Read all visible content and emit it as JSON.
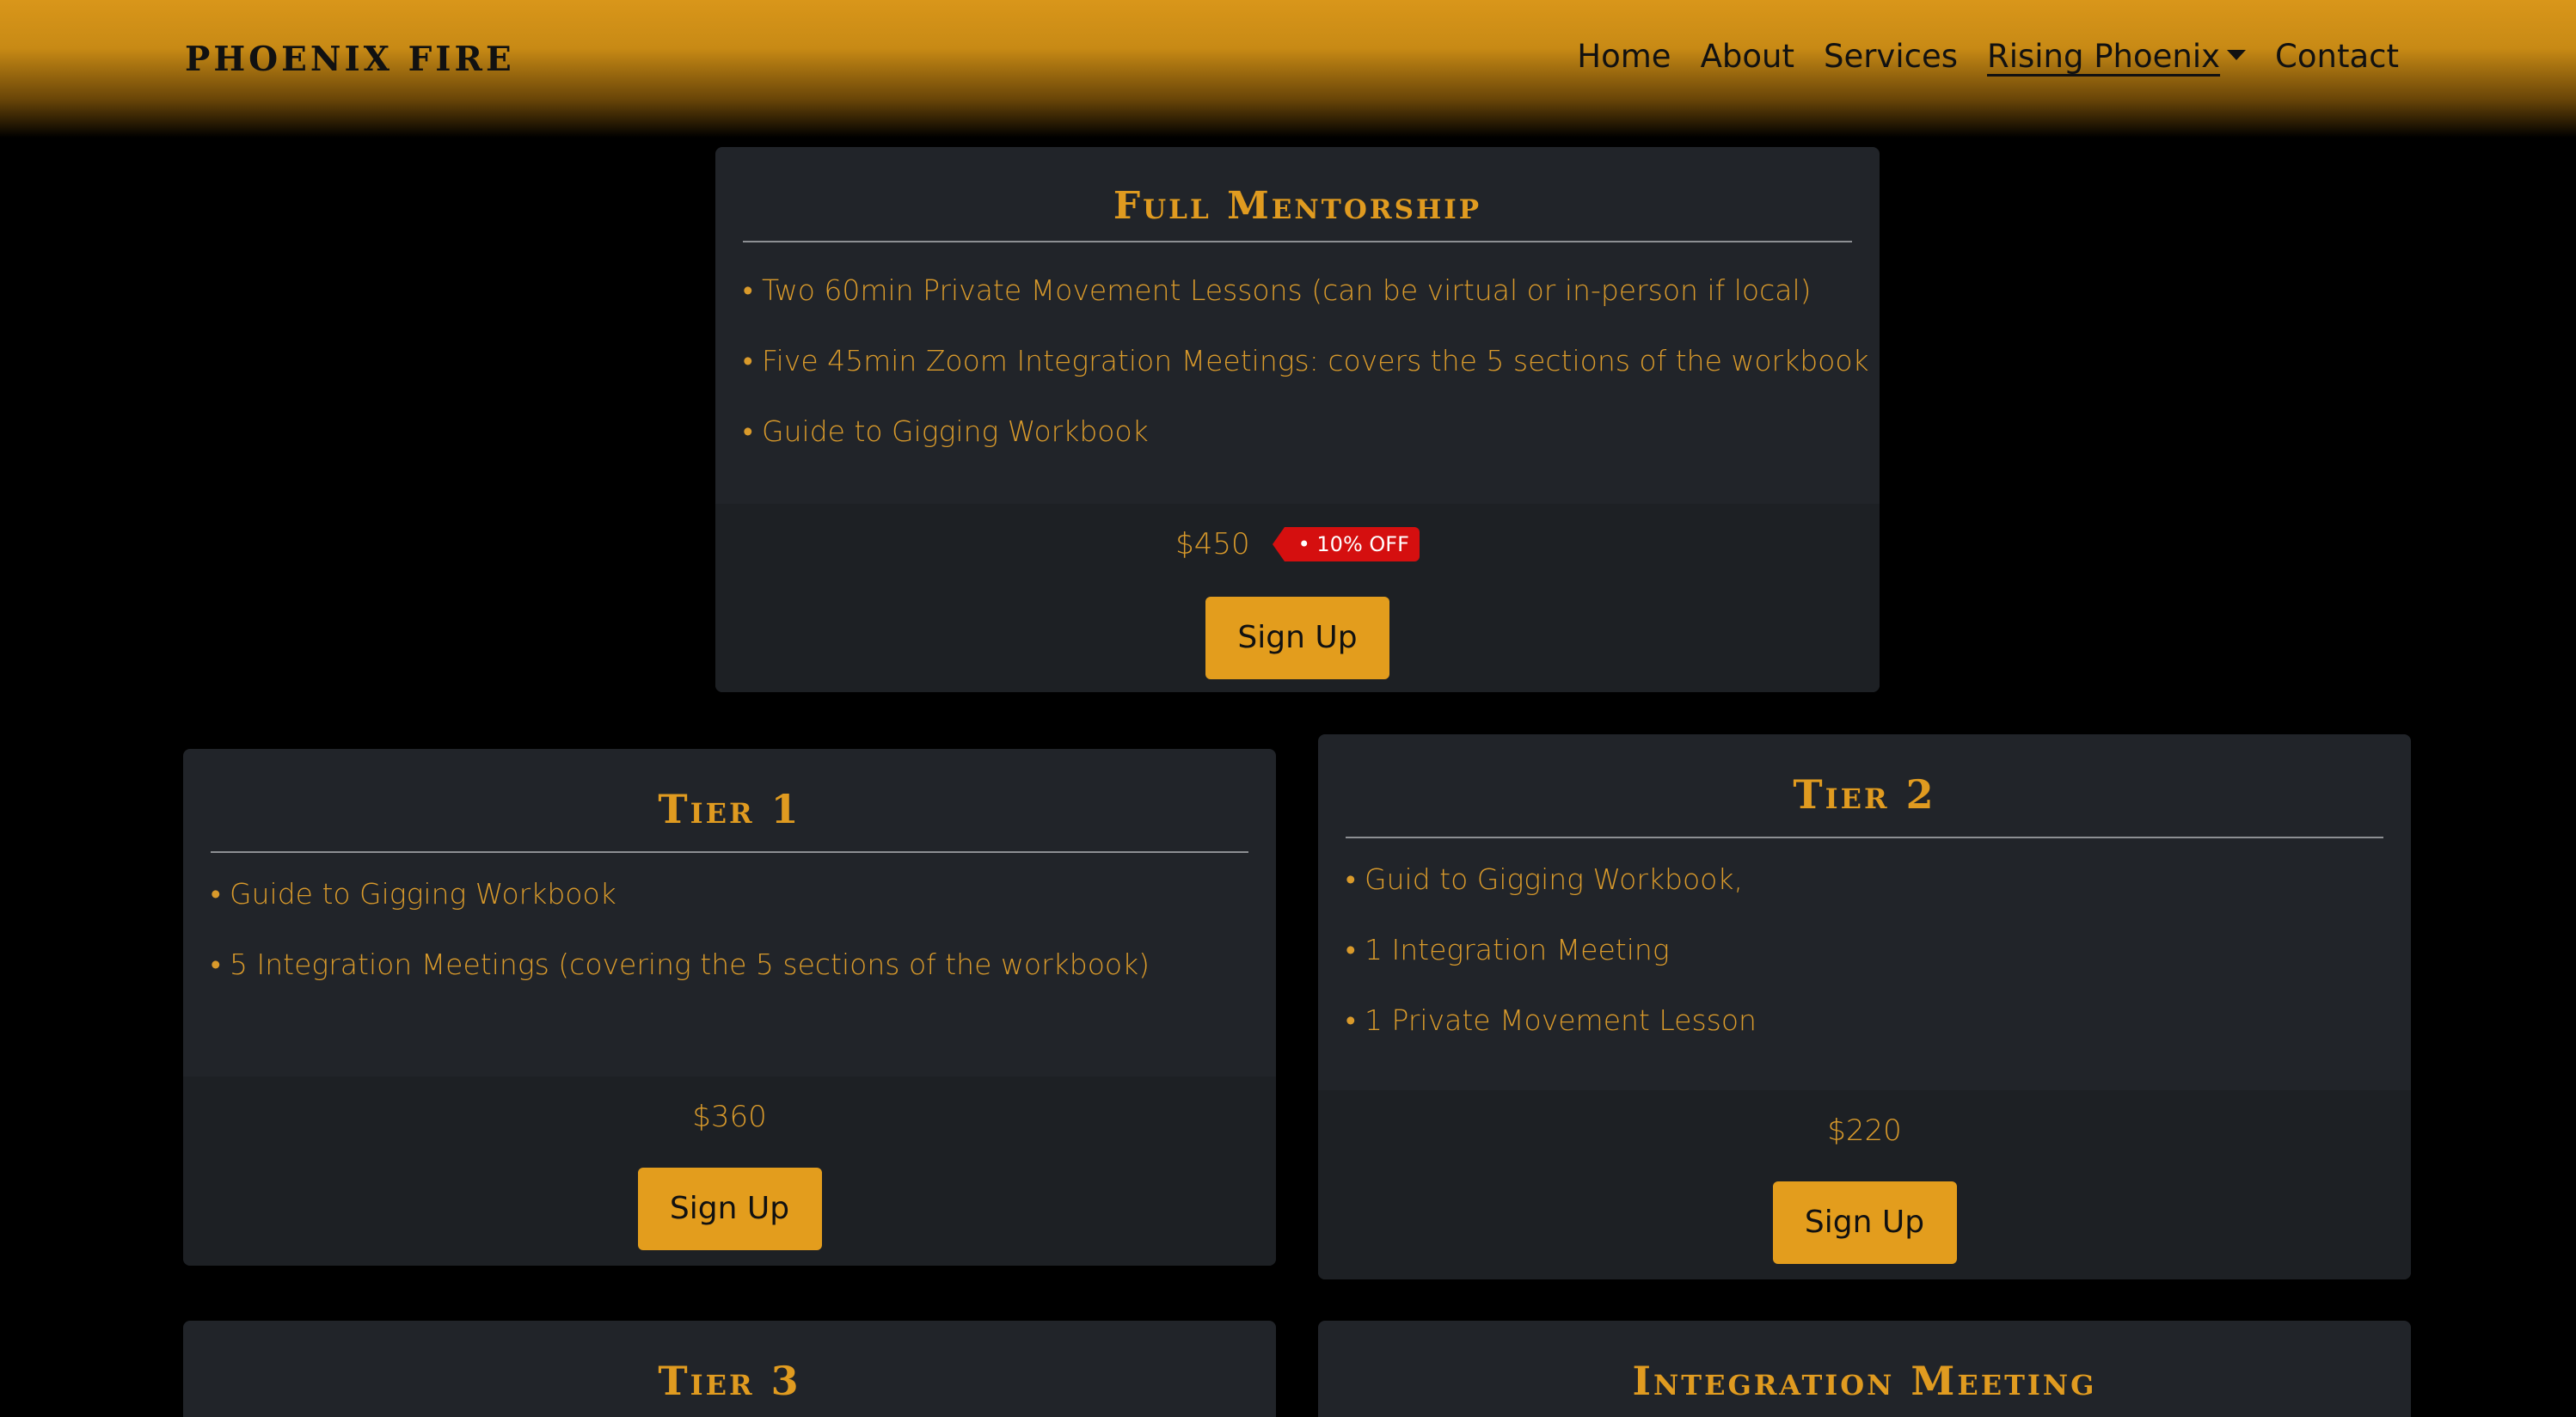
{
  "navbar": {
    "brand": "PHOENIX FIRE",
    "links": [
      {
        "label": "Home"
      },
      {
        "label": "About"
      },
      {
        "label": "Services"
      },
      {
        "label": "Rising Phoenix"
      },
      {
        "label": "Contact"
      }
    ]
  },
  "cards": {
    "full_mentorship": {
      "title": "Full Mentorship",
      "items": [
        "• Two 60min Private Movement Lessons (can be virtual or in-person if local)",
        "• Five 45min Zoom Integration Meetings: covers the 5 sections of the workbook",
        "• Guide to Gigging Workbook"
      ],
      "price": "$450",
      "badge": "• 10% OFF",
      "button": "Sign Up"
    },
    "tier1": {
      "title": "Tier 1",
      "items": [
        "• Guide to Gigging Workbook",
        "• 5 Integration Meetings (covering the 5 sections of the workbook)"
      ],
      "price": "$360",
      "button": "Sign Up"
    },
    "tier2": {
      "title": "Tier 2",
      "items": [
        "• Guid to Gigging Workbook,",
        "• 1 Integration Meeting",
        "• 1 Private Movement Lesson"
      ],
      "price": "$220",
      "button": "Sign Up"
    },
    "tier3": {
      "title": "Tier 3"
    },
    "integration_meeting": {
      "title": "Integration Meeting"
    }
  },
  "colors": {
    "accent": "#e39d1d",
    "card_bg": "#212429",
    "page_bg": "#000000",
    "badge": "#d50f0f"
  }
}
